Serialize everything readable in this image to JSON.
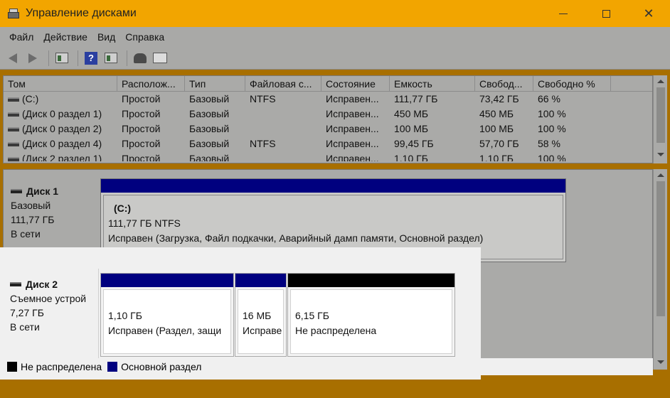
{
  "window": {
    "title": "Управление дисками",
    "controls": {
      "minimize": "—",
      "maximize": "☐",
      "close": "✕"
    }
  },
  "menu": [
    "Файл",
    "Действие",
    "Вид",
    "Справка"
  ],
  "columns": [
    "Том",
    "Располож...",
    "Тип",
    "Файловая с...",
    "Состояние",
    "Емкость",
    "Свобод...",
    "Свободно %"
  ],
  "volumes": [
    [
      "(C:)",
      "Простой",
      "Базовый",
      "NTFS",
      "Исправен...",
      "111,77 ГБ",
      "73,42 ГБ",
      "66 %"
    ],
    [
      "(Диск 0 раздел 1)",
      "Простой",
      "Базовый",
      "",
      "Исправен...",
      "450 МБ",
      "450 МБ",
      "100 %"
    ],
    [
      "(Диск 0 раздел 2)",
      "Простой",
      "Базовый",
      "",
      "Исправен...",
      "100 МБ",
      "100 МБ",
      "100 %"
    ],
    [
      "(Диск 0 раздел 4)",
      "Простой",
      "Базовый",
      "NTFS",
      "Исправен...",
      "99,45 ГБ",
      "57,70 ГБ",
      "58 %"
    ],
    [
      "(Диск 2 раздел 1)",
      "Простой",
      "Базовый",
      "",
      "Исправен...",
      "1,10 ГБ",
      "1,10 ГБ",
      "100 %"
    ]
  ],
  "disk1": {
    "name": "Диск 1",
    "type": "Базовый",
    "size": "111,77 ГБ",
    "status": "В сети",
    "partition": {
      "label": "(C:)",
      "size_fs": "111,77 ГБ NTFS",
      "status": "Исправен (Загрузка, Файл подкачки, Аварийный дамп памяти, Основной раздел)"
    }
  },
  "disk2": {
    "name": "Диск 2",
    "type": "Съемное устрой",
    "size": "7,27 ГБ",
    "status": "В сети",
    "partitions": [
      {
        "size": "1,10 ГБ",
        "status": "Исправен (Раздел, защи"
      },
      {
        "size": "16 МБ",
        "status": "Исправе"
      },
      {
        "size": "6,15 ГБ",
        "status": "Не распределена"
      }
    ]
  },
  "legend": [
    {
      "label": "Не распределена",
      "color": "#000000"
    },
    {
      "label": "Основной раздел",
      "color": "#00007f"
    }
  ],
  "colors": {
    "titlebar": "#f2a500",
    "primary": "#00007f",
    "unallocated": "#000000"
  }
}
